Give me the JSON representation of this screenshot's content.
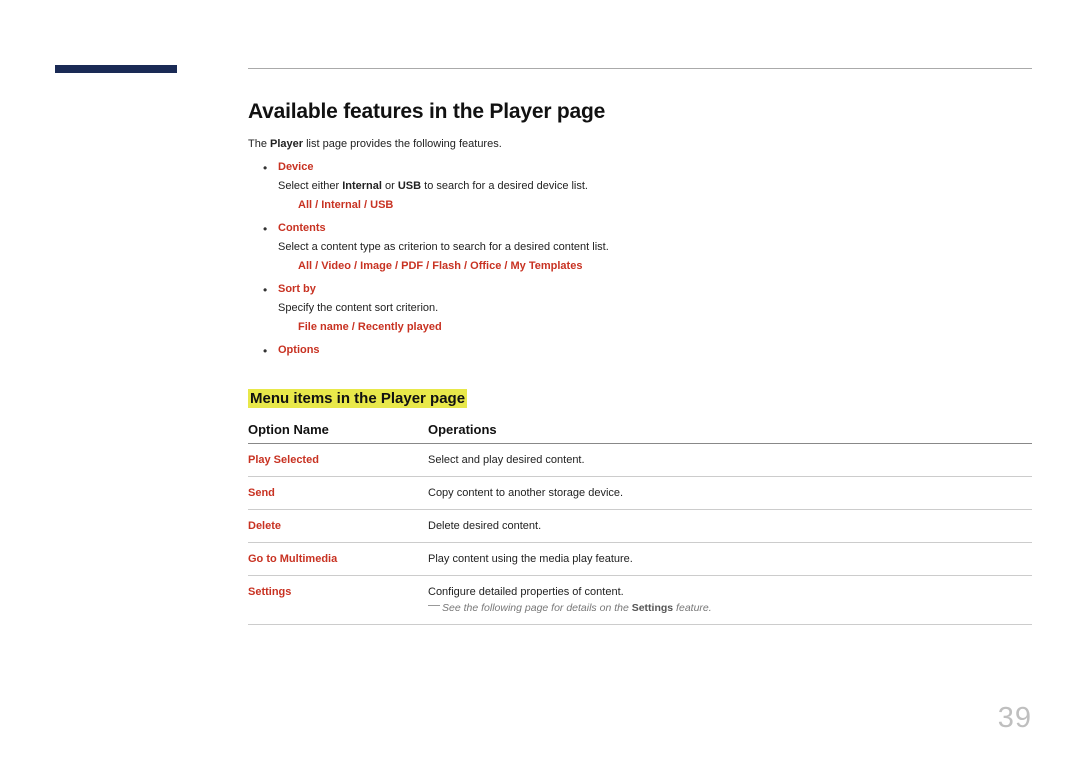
{
  "page_number": "39",
  "heading": "Available features in the Player page",
  "intro_pre": "The ",
  "intro_player": "Player",
  "intro_post": " list page provides the following features.",
  "features": [
    {
      "label": "Device",
      "desc_pre": "Select either ",
      "desc_b1": "Internal",
      "desc_mid": " or ",
      "desc_b2": "USB",
      "desc_post": " to search for a desired device list.",
      "path": "All / Internal / USB"
    },
    {
      "label": "Contents",
      "desc_plain": "Select a content type as criterion to search for a desired content list.",
      "path": "All / Video / Image / PDF / Flash / Office / My Templates"
    },
    {
      "label": "Sort by",
      "desc_plain": "Specify the content sort criterion.",
      "path": "File name / Recently played"
    },
    {
      "label": "Options"
    }
  ],
  "subheading": "Menu items in the Player page",
  "table_headers": {
    "name": "Option Name",
    "ops": "Operations"
  },
  "table_rows": [
    {
      "name": "Play Selected",
      "desc": "Select and play desired content."
    },
    {
      "name": "Send",
      "desc": "Copy content to another storage device."
    },
    {
      "name": "Delete",
      "desc": "Delete desired content."
    },
    {
      "name": "Go to Multimedia",
      "desc": "Play content using the media play feature."
    },
    {
      "name": "Settings",
      "desc": "Configure detailed properties of content.",
      "note_pre": "See the following page for details on the ",
      "note_bold": "Settings",
      "note_post": " feature."
    }
  ]
}
